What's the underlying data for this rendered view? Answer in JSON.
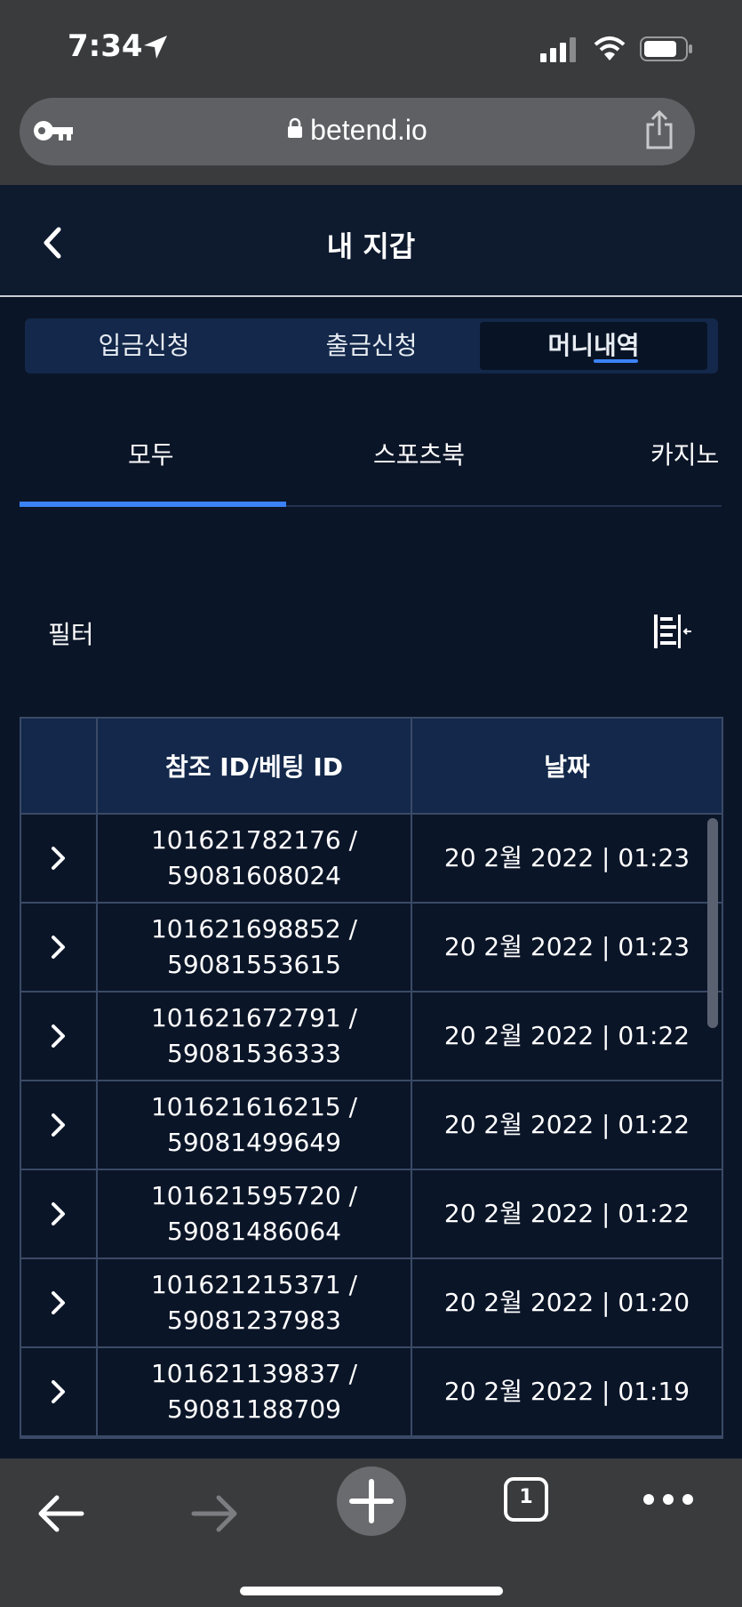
{
  "status": {
    "time": "7:34"
  },
  "browser": {
    "url": "betend.io",
    "tab_count": "1"
  },
  "header": {
    "title": "내 지갑"
  },
  "tabs": [
    {
      "label": "입금신청"
    },
    {
      "label": "출금신청"
    },
    {
      "label": "머니내역",
      "active": true
    }
  ],
  "subtabs": [
    {
      "label": "모두",
      "active": true
    },
    {
      "label": "스포츠북"
    },
    {
      "label": "카지노"
    }
  ],
  "filter": {
    "label": "필터"
  },
  "table": {
    "headers": [
      "",
      "참조 ID/베팅 ID",
      "날짜"
    ],
    "rows": [
      {
        "ref": "101621782176 /",
        "bet": "59081608024",
        "date": "20 2월 2022 | 01:23"
      },
      {
        "ref": "101621698852 /",
        "bet": "59081553615",
        "date": "20 2월 2022 | 01:23"
      },
      {
        "ref": "101621672791 /",
        "bet": "59081536333",
        "date": "20 2월 2022 | 01:22"
      },
      {
        "ref": "101621616215 /",
        "bet": "59081499649",
        "date": "20 2월 2022 | 01:22"
      },
      {
        "ref": "101621595720 /",
        "bet": "59081486064",
        "date": "20 2월 2022 | 01:22"
      },
      {
        "ref": "101621215371 /",
        "bet": "59081237983",
        "date": "20 2월 2022 | 01:20"
      },
      {
        "ref": "101621139837 /",
        "bet": "59081188709",
        "date": "20 2월 2022 | 01:19"
      }
    ]
  },
  "colors": {
    "accent": "#3b82f6",
    "background": "#0b1528",
    "header_bg": "#13284a"
  }
}
